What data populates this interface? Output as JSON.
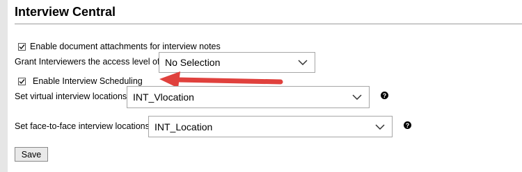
{
  "page": {
    "title": "Interview Central"
  },
  "options": {
    "attachments_label": "Enable document attachments for interview notes",
    "access_label": "Grant Interviewers the access level of",
    "access_value": "No Selection",
    "scheduling_label": "Enable Interview Scheduling",
    "virtual_label": "Set virtual interview locations",
    "virtual_value": "INT_Vlocation",
    "face_label": "Set face-to-face interview locations",
    "face_value": "INT_Location"
  },
  "help_glyph": "?",
  "save_label": "Save",
  "colors": {
    "annotation_arrow": "#e0413d"
  },
  "icons": [
    "checkbox-checked-icon",
    "chevron-down-icon",
    "help-icon",
    "annotation-arrow"
  ]
}
